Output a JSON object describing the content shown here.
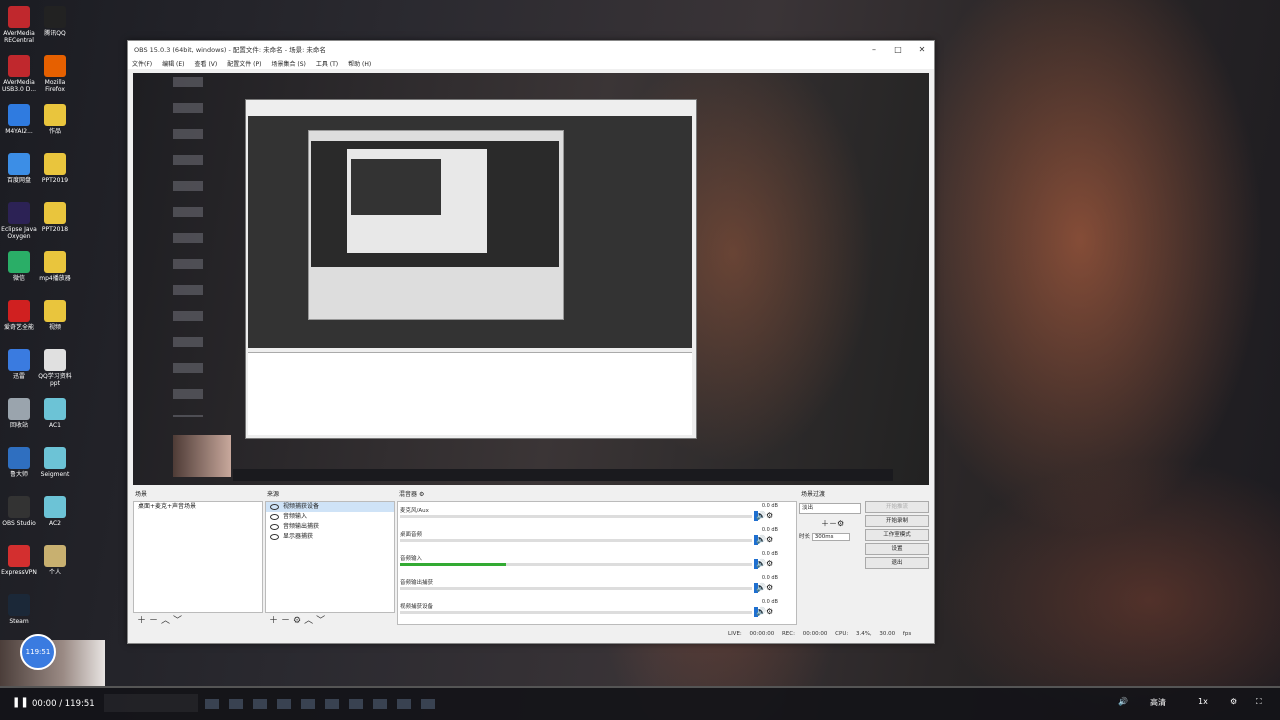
{
  "desktop_icons": [
    {
      "label": "AVerMedia RECentral",
      "color": "#c0282d"
    },
    {
      "label": "腾讯QQ",
      "color": "#222"
    },
    {
      "label": "AVerMedia USB3.0 D...",
      "color": "#c0282d"
    },
    {
      "label": "Mozilla Firefox",
      "color": "#e66000"
    },
    {
      "label": "M4YAI2...",
      "color": "#2f7be0"
    },
    {
      "label": "作品",
      "color": "#e9c53d"
    },
    {
      "label": "百度网盘",
      "color": "#3c8ee6"
    },
    {
      "label": "PPT2019",
      "color": "#e9c53d"
    },
    {
      "label": "Eclipse Java Oxygen",
      "color": "#2c2255"
    },
    {
      "label": "PPT2018",
      "color": "#e9c53d"
    },
    {
      "label": "微信",
      "color": "#2aae67"
    },
    {
      "label": "mp4播放器",
      "color": "#e9c53d"
    },
    {
      "label": "爱奇艺全能",
      "color": "#d02020"
    },
    {
      "label": "视频",
      "color": "#e9c53d"
    },
    {
      "label": "迅雷",
      "color": "#3a7be0"
    },
    {
      "label": "QQ学习资料ppt",
      "color": "#e0e0e0"
    },
    {
      "label": "回收站",
      "color": "#9aa4ad"
    },
    {
      "label": "AC1",
      "color": "#6cc3d6"
    },
    {
      "label": "鲁大师",
      "color": "#2f6fc0"
    },
    {
      "label": "Seigment",
      "color": "#6cc3d6"
    },
    {
      "label": "OBS Studio",
      "color": "#333"
    },
    {
      "label": "AC2",
      "color": "#6cc3d6"
    },
    {
      "label": "ExpressVPN",
      "color": "#d32f2f"
    },
    {
      "label": "个人",
      "color": "#c8b070"
    },
    {
      "label": "Steam",
      "color": "#1b2838"
    }
  ],
  "obs": {
    "title": "OBS 15.0.3 (64bit, windows) - 配置文件: 未命名 - 场景: 未命名",
    "menu": [
      "文件(F)",
      "编辑 (E)",
      "查看 (V)",
      "配置文件 (P)",
      "场景集合 (S)",
      "工具 (T)",
      "帮助 (H)"
    ],
    "scenes": {
      "header": "场景",
      "items": [
        "桌面+麦克+声音场景"
      ]
    },
    "sources": {
      "header": "来源",
      "items": [
        "视频捕获设备",
        "音频输入",
        "音频输出捕获",
        "显示器捕获"
      ]
    },
    "mixer": {
      "header": "混音器",
      "rows": [
        {
          "label": "麦克风/Aux",
          "db": "0.0 dB",
          "level": 0
        },
        {
          "label": "桌面音频",
          "db": "0.0 dB",
          "level": 0
        },
        {
          "label": "音频输入",
          "db": "0.0 dB",
          "level": 0.3
        },
        {
          "label": "音频输出捕获",
          "db": "0.0 dB",
          "level": 0
        },
        {
          "label": "视频捕获设备",
          "db": "0.0 dB",
          "level": 0
        }
      ]
    },
    "transitions": {
      "header": "场景过渡",
      "selected": "淡出",
      "duration_label": "时长",
      "duration": "300ms"
    },
    "controls": [
      "开始推流",
      "开始录制",
      "工作室模式",
      "设置",
      "退出"
    ],
    "status": "LIVE: 00:00:00   REC: 00:00:00   CPU: 3.4%, 30.00 fps"
  },
  "player": {
    "time": "00:00 / 119:51",
    "timer_badge": "119:51",
    "progress": 0,
    "quality": "高清",
    "speed": "1x"
  }
}
